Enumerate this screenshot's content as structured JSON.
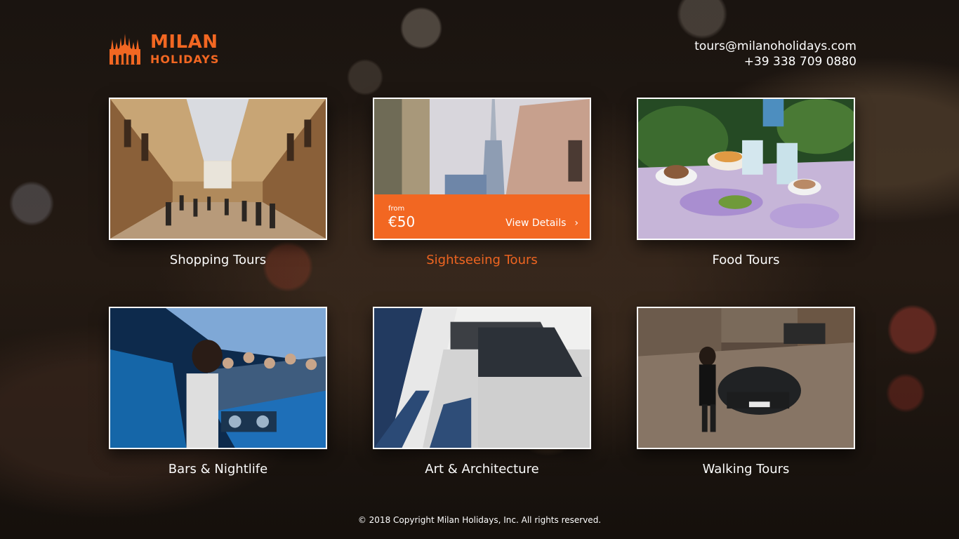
{
  "brand": {
    "line1": "MILAN",
    "line2": "HOLIDAYS",
    "accent_color": "#f26722",
    "icon": "cathedral-icon"
  },
  "contact": {
    "email": "tours@milanoholidays.com",
    "phone": "+39 338 709 0880"
  },
  "tours": [
    {
      "title": "Shopping Tours",
      "image": "galleria-arcade-photo"
    },
    {
      "title": "Sightseeing Tours",
      "image": "city-skyscraper-photo",
      "active": true,
      "price_from_label": "from",
      "price": "€50",
      "cta_label": "View Details",
      "cta_icon": "chevron-right-icon"
    },
    {
      "title": "Food Tours",
      "image": "outdoor-cafe-table-photo"
    },
    {
      "title": "Bars & Nightlife",
      "image": "dj-nightclub-photo"
    },
    {
      "title": "Art & Architecture",
      "image": "modern-building-photo"
    },
    {
      "title": "Walking Tours",
      "image": "street-vintage-car-photo"
    }
  ],
  "footer": {
    "copyright": "© 2018 Copyright Milan Holidays, Inc. All rights reserved."
  }
}
